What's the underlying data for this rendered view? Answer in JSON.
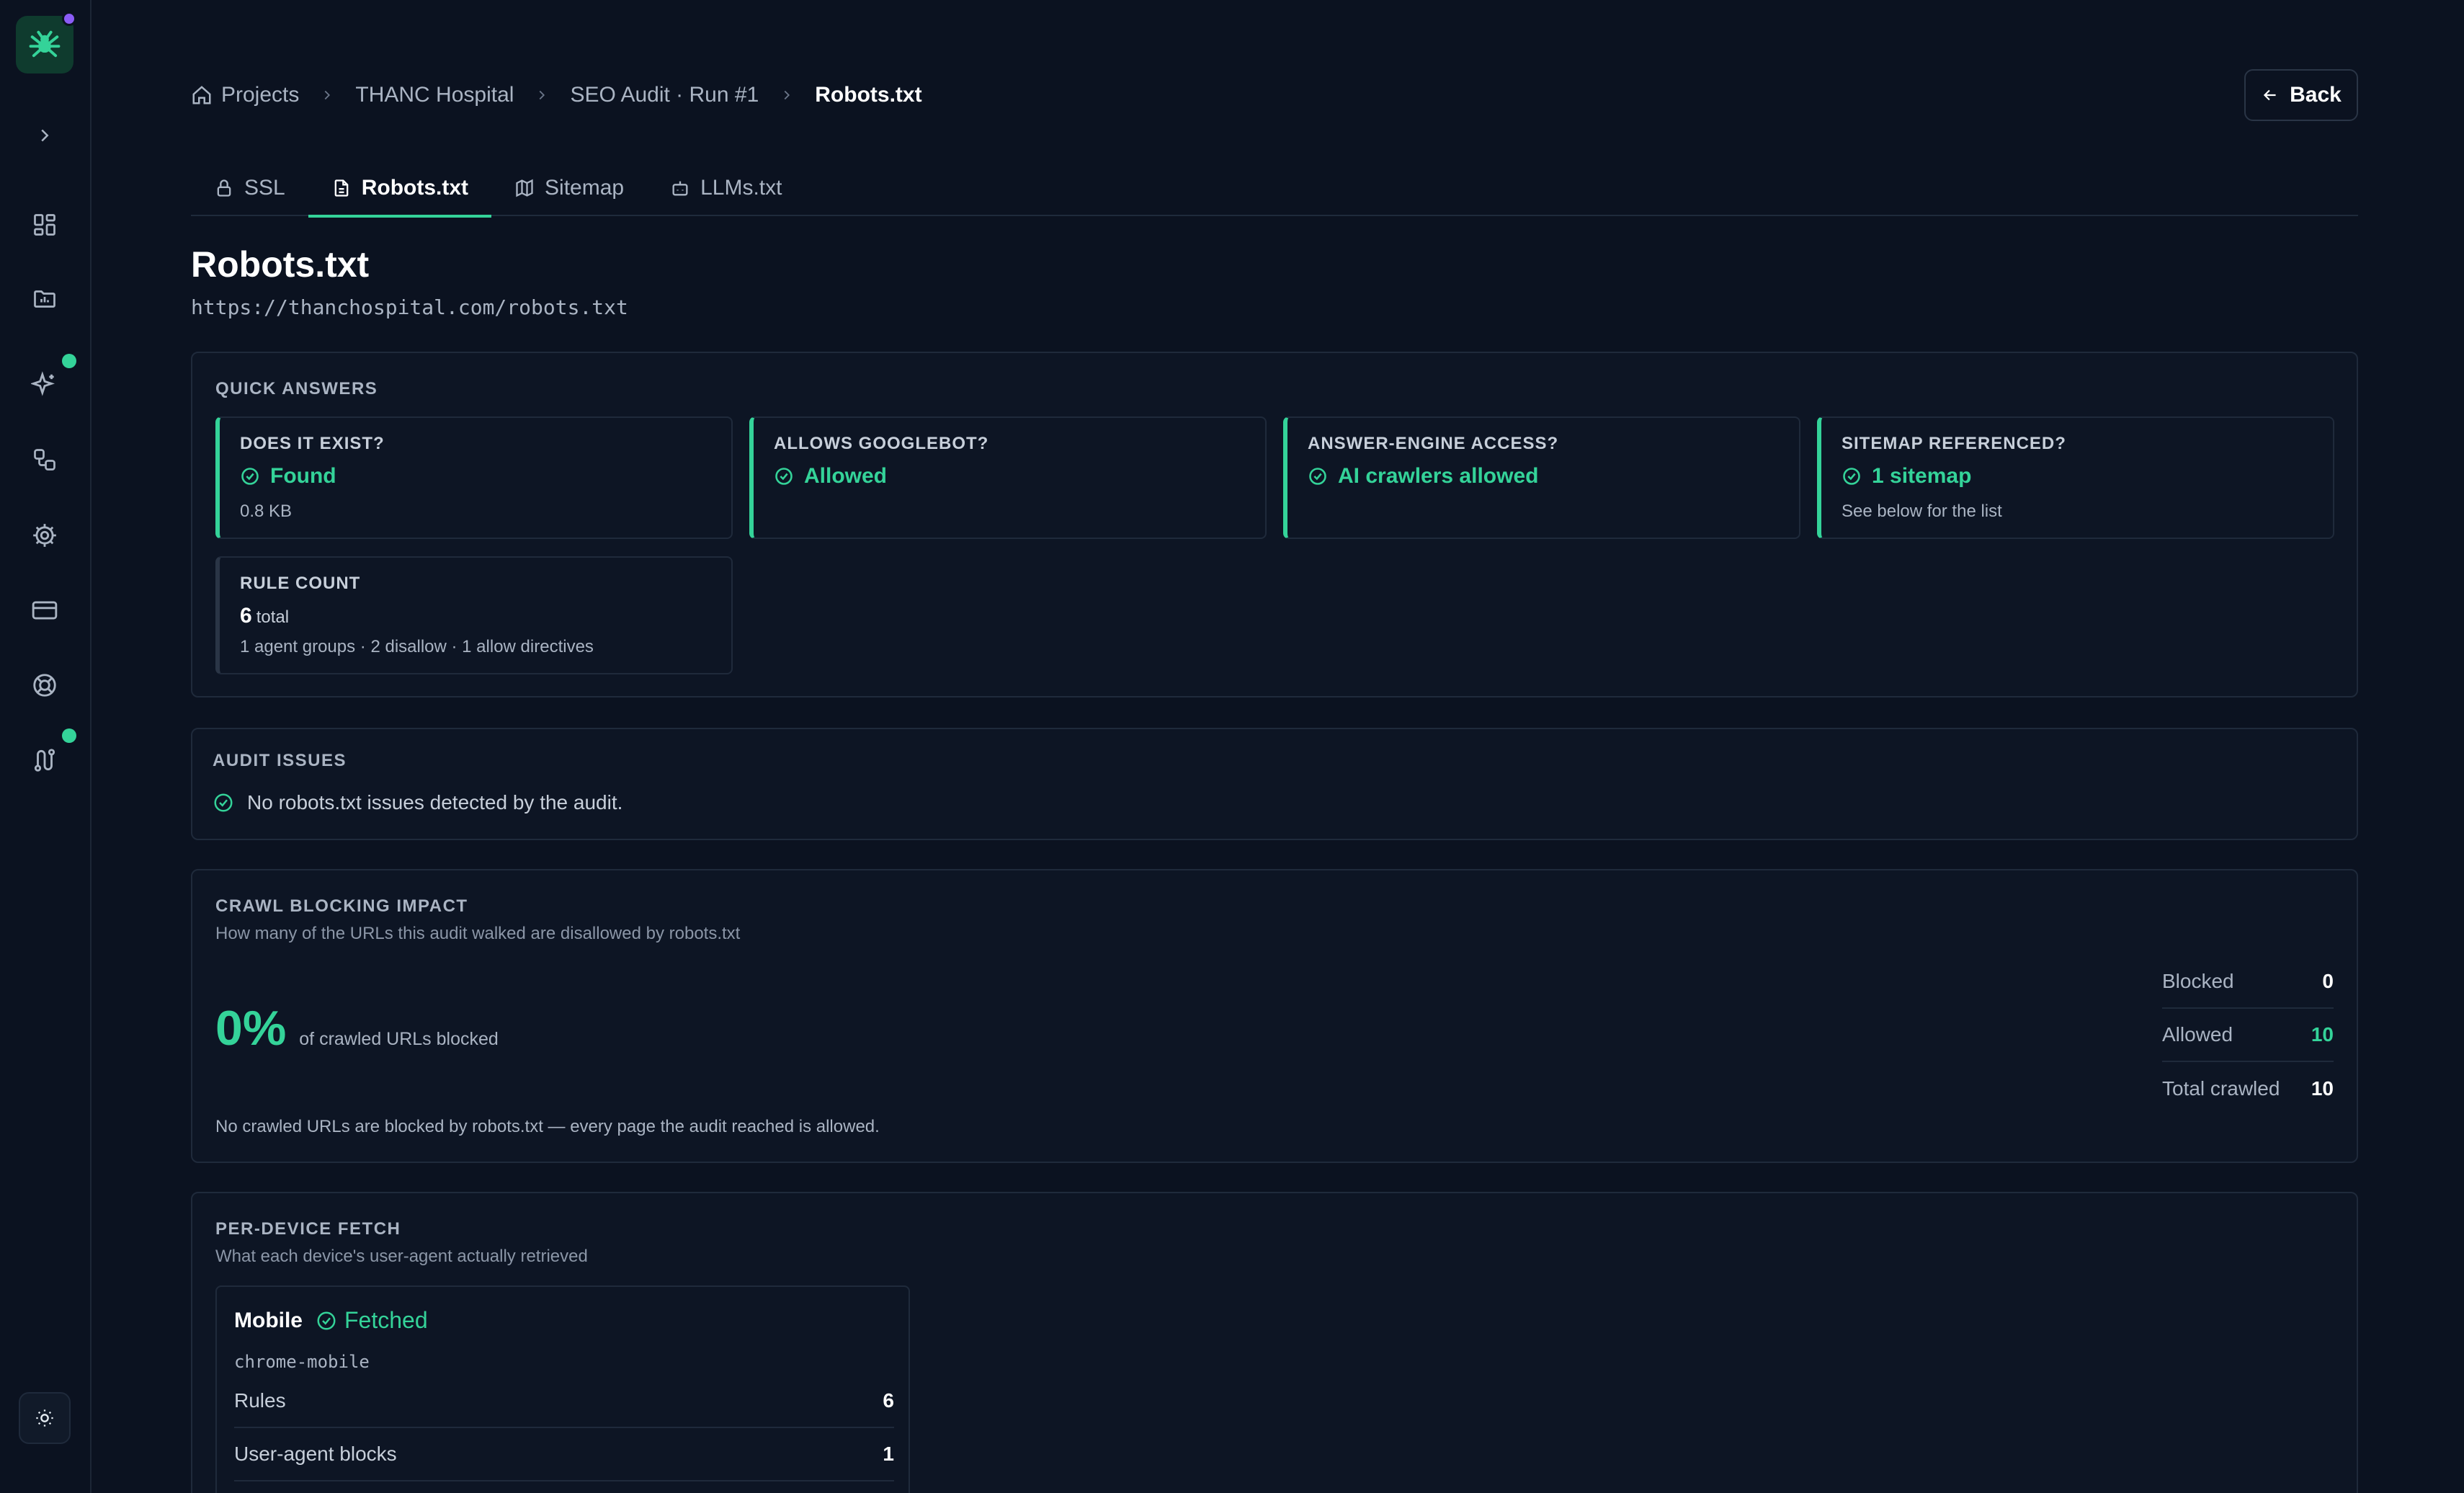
{
  "sidebar": {
    "icons": [
      "dashboard-icon",
      "folder-chart-icon",
      "sparkles-icon",
      "workflow-icon",
      "gear-icon",
      "credit-card-icon",
      "lifebuoy-icon",
      "route-icon"
    ],
    "theme_icon": "sun-icon"
  },
  "breadcrumb": {
    "items": [
      "Projects",
      "THANC Hospital",
      "SEO Audit · Run #1",
      "Robots.txt"
    ]
  },
  "back_label": "Back",
  "tabs": [
    {
      "label": "SSL",
      "icon": "lock-icon"
    },
    {
      "label": "Robots.txt",
      "icon": "file-text-icon"
    },
    {
      "label": "Sitemap",
      "icon": "map-icon"
    },
    {
      "label": "LLMs.txt",
      "icon": "bot-icon"
    }
  ],
  "active_tab": "Robots.txt",
  "page": {
    "title": "Robots.txt",
    "url": "https://thanchospital.com/robots.txt"
  },
  "quick_answers": {
    "heading": "QUICK ANSWERS",
    "tiles": [
      {
        "label": "DOES IT EXIST?",
        "value": "Found",
        "note": "0.8 KB"
      },
      {
        "label": "ALLOWS GOOGLEBOT?",
        "value": "Allowed",
        "note": ""
      },
      {
        "label": "ANSWER-ENGINE ACCESS?",
        "value": "AI crawlers allowed",
        "note": ""
      },
      {
        "label": "SITEMAP REFERENCED?",
        "value": "1 sitemap",
        "note": "See below for the list"
      }
    ],
    "rule_count": {
      "label": "RULE COUNT",
      "value": "6",
      "unit": "total",
      "note": "1 agent groups · 2 disallow · 1 allow directives"
    }
  },
  "audit_issues": {
    "heading": "AUDIT ISSUES",
    "message": "No robots.txt issues detected by the audit."
  },
  "crawl_blocking": {
    "heading": "CRAWL BLOCKING IMPACT",
    "subheading": "How many of the URLs this audit walked are disallowed by robots.txt",
    "percent": "0%",
    "percent_label": "of crawled URLs blocked",
    "note": "No crawled URLs are blocked by robots.txt — every page the audit reached is allowed.",
    "stats": [
      {
        "label": "Blocked",
        "value": "0"
      },
      {
        "label": "Allowed",
        "value": "10"
      },
      {
        "label": "Total crawled",
        "value": "10"
      }
    ]
  },
  "per_device": {
    "heading": "PER-DEVICE FETCH",
    "subheading": "What each device's user-agent actually retrieved",
    "device": {
      "name": "Mobile",
      "status": "Fetched",
      "user_agent": "chrome-mobile",
      "rows": [
        {
          "label": "Rules",
          "value": "6"
        },
        {
          "label": "User-agent blocks",
          "value": "1"
        }
      ]
    }
  },
  "colors": {
    "accent": "#34d399",
    "background": "#0b1220",
    "purple_dot": "#8b5cf6"
  }
}
